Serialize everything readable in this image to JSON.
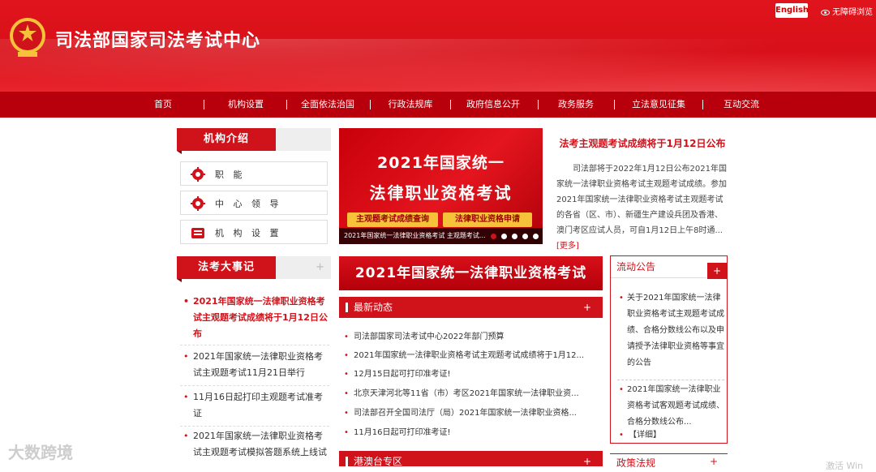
{
  "header": {
    "site_title": "司法部国家司法考试中心",
    "lang_button": "English",
    "accessibility": "无障碍浏览"
  },
  "nav": [
    "首页",
    "机构设置",
    "全面依法治国",
    "行政法规库",
    "政府信息公开",
    "政务服务",
    "立法意见征集",
    "互动交流"
  ],
  "institution": {
    "title": "机构介绍",
    "items": [
      {
        "label": "职 能",
        "icon": "gear-icon"
      },
      {
        "label": "中 心 领 导",
        "icon": "gear-icon"
      },
      {
        "label": "机 构 设 置",
        "icon": "book-icon"
      }
    ]
  },
  "events": {
    "title": "法考大事记",
    "plus": "+",
    "items": [
      "2021年国家统一法律职业资格考试主观题考试成绩将于1月12日公布",
      "2021年国家统一法律职业资格考试主观题考试11月21日举行",
      "11月16日起打印主观题考试准考证",
      "2021年国家统一法律职业资格考试主观题考试模拟答题系统上线试"
    ]
  },
  "banner": {
    "line1": "2021年国家统一",
    "line2": "法律职业资格考试",
    "btn1": "主观题考试成绩查询",
    "btn2": "法律职业资格申请",
    "caption": "2021年国家统一法律职业资格考试 主观题考试..."
  },
  "headline": {
    "title": "法考主观题考试成绩将于1月12日公布",
    "body": "司法部将于2022年1月12日公布2021年国家统一法律职业资格考试主观题考试成绩。参加2021年国家统一法律职业资格考试主观题考试的各省（区、市）、新疆生产建设兵团及香港、澳门考区应试人员，可自1月12日上午8时通...",
    "more": "[更多]"
  },
  "red_bar": "2021年国家统一法律职业资格考试",
  "news": {
    "title": "最新动态",
    "plus": "+",
    "items": [
      "司法部国家司法考试中心2022年部门预算",
      "2021年国家统一法律职业资格考试主观题考试成绩将于1月12...",
      "12月15日起可打印准考证!",
      "北京天津河北等11省（市）考区2021年国家统一法律职业资...",
      "司法部召开全国司法厅（局）2021年国家统一法律职业资格...",
      "11月16日起可打印准考证!"
    ]
  },
  "hk_macao": {
    "title": "港澳台专区",
    "plus": "+"
  },
  "notice": {
    "title": "流动公告",
    "plus": "+",
    "items": [
      "关于2021年国家统一法律职业资格考试主观题考试成绩、合格分数线公布以及申请授予法律职业资格等事宜的公告",
      "2021年国家统一法律职业资格考试客观题考试成绩、合格分数线公布..."
    ],
    "detail": "【详细】"
  },
  "policy": {
    "title": "政策法规",
    "plus": "+"
  },
  "watermark": "大数跨境",
  "watermark2": "激活 Win"
}
